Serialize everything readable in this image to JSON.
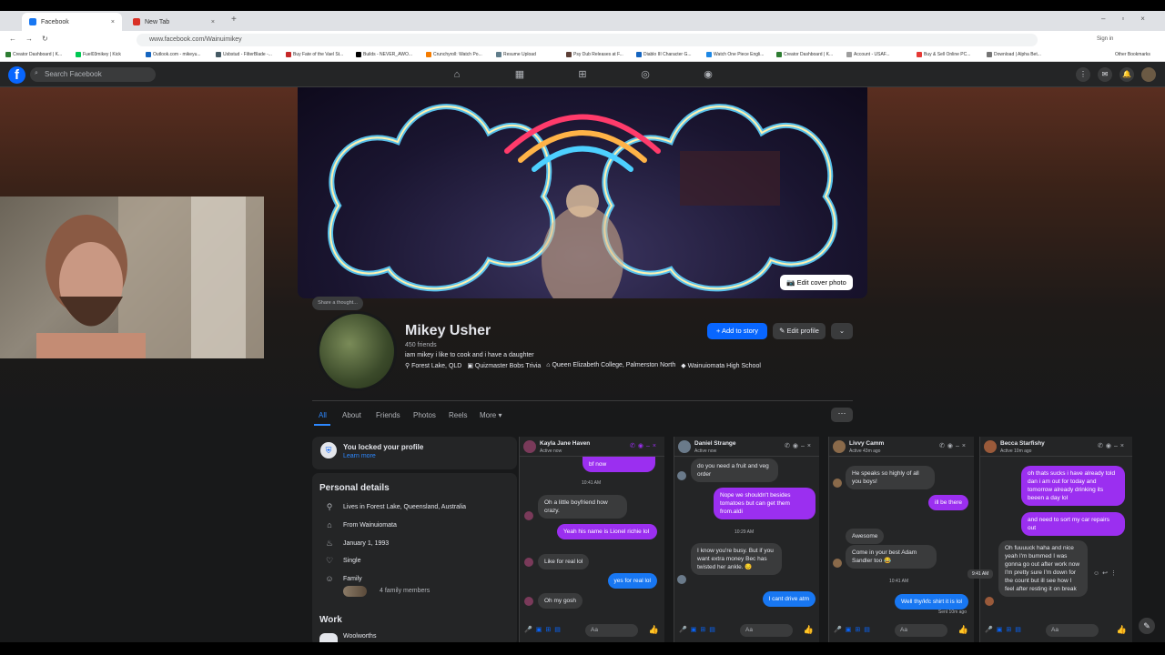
{
  "browser": {
    "tabs": [
      {
        "label": "Facebook",
        "favicon_color": "#1877f2"
      },
      {
        "label": "New Tab",
        "favicon_color": "#d93025"
      }
    ],
    "url": "www.facebook.com/Wainuimikey",
    "sign_in": "Sign in",
    "other_bookmarks": "Other Bookmarks",
    "bookmarks": [
      "Creator Dashboard | K...",
      "Fuel03mikey | Kick",
      "Outlook.com - mikeyu...",
      "Usbstud - FilterBlade -...",
      "Buy Fate of the Vael St...",
      "Builds - NEVER_AWO...",
      "Crunchyroll: Watch Po...",
      "Resume Upload",
      "Psy Dub Releases at F...",
      "Diablo III Character G...",
      "Watch One Piece Engli...",
      "Creator Dashboard | K...",
      "Account - USAF...",
      "Buy & Sell Online PC...",
      "Download | Alpha Bet..."
    ]
  },
  "fb": {
    "search_placeholder": "Search Facebook",
    "nav_icons": [
      "home-icon",
      "calendar-icon",
      "marketplace-icon",
      "groups-icon",
      "gaming-icon"
    ]
  },
  "cover": {
    "edit_label": "Edit cover photo"
  },
  "profile": {
    "share_thought": "Share a thought...",
    "name": "Mikey Usher",
    "friends": "450 friends",
    "bio": "iam mikey i like to cook and i have a daughter",
    "info": [
      "Forest Lake, QLD",
      "Quizmaster Bobs Trivia",
      "Queen Elizabeth College, Palmerston North",
      "Wainuiomata High School"
    ],
    "add_story": "+ Add to story",
    "edit_profile": "Edit profile",
    "tabs": [
      "All",
      "About",
      "Friends",
      "Photos",
      "Reels",
      "More ▾"
    ]
  },
  "locked": {
    "title": "You locked your profile",
    "link": "Learn more"
  },
  "personal": {
    "title": "Personal details",
    "items": [
      {
        "icon": "location-icon",
        "text": "Lives in Forest Lake, Queensland, Australia"
      },
      {
        "icon": "home-icon",
        "text": "From Wainuiomata"
      },
      {
        "icon": "birthday-icon",
        "text": "January 1, 1993"
      },
      {
        "icon": "relationship-icon",
        "text": "Single"
      },
      {
        "icon": "family-icon",
        "text": "Family"
      }
    ],
    "family_members": "4 family members",
    "work_title": "Work",
    "work_item": "Woolworths"
  },
  "chats": [
    {
      "name": "Kayla Jane Haven",
      "status": "Active now",
      "messages": [
        {
          "dir": "out",
          "text": "bf now"
        },
        {
          "dir": "ts",
          "text": "10:41 AM"
        },
        {
          "dir": "in",
          "text": "Oh a little boyfriend how crazy."
        },
        {
          "dir": "out",
          "text": "Yeah his name is Lionel richie lol"
        },
        {
          "dir": "in",
          "text": "Like for real lol"
        },
        {
          "dir": "out2",
          "text": "yes for real lol"
        },
        {
          "dir": "in",
          "text": "Oh my gosh"
        }
      ]
    },
    {
      "name": "Daniel Strange",
      "status": "Active now",
      "messages": [
        {
          "dir": "in",
          "text": "do you need a fruit and veg order"
        },
        {
          "dir": "out",
          "text": "Nope we shouldn't besides tomatoes but can get them from.aldi"
        },
        {
          "dir": "ts",
          "text": "10:29 AM"
        },
        {
          "dir": "in",
          "text": "I know you're busy. But if you want extra money Bec has twisted her ankle. 😔"
        },
        {
          "dir": "out2",
          "text": "I cant drive atm"
        }
      ]
    },
    {
      "name": "Livvy Camm",
      "status": "Active 43m ago",
      "messages": [
        {
          "dir": "in",
          "text": "He speaks so highly of all you boys!"
        },
        {
          "dir": "out",
          "text": "ill be there"
        },
        {
          "dir": "in",
          "text": "Awesome"
        },
        {
          "dir": "in",
          "text": "Come in your best Adam Sandler too 😂"
        },
        {
          "dir": "ts",
          "text": "10:41 AM"
        },
        {
          "dir": "out2",
          "text": "Well thy/kfc shirt it is lol"
        },
        {
          "dir": "ts",
          "text": "Sent 10m ago"
        }
      ]
    },
    {
      "name": "Becca Starfishy",
      "status": "Active 10m ago",
      "messages": [
        {
          "dir": "out",
          "text": "oh thats sucks i have already told dan i am out for today and tomorrow already drinking its beeen a day lol"
        },
        {
          "dir": "out",
          "text": "and need to sort my car repairs out"
        },
        {
          "dir": "in",
          "text": "Oh fuuuuck haha and nice yeah I'm bummed I was gonna go out after work now I'm pretty sure I'm down for the count but ill see how I feel after resting it on break"
        },
        {
          "dir": "ts",
          "text": "9:41 AM"
        }
      ]
    }
  ],
  "chat_input_placeholder": "Aa",
  "colors": {
    "fb_blue": "#0866ff",
    "msg_purple": "#9b2ff0",
    "bg_dark": "#18191a",
    "card": "#242526"
  }
}
